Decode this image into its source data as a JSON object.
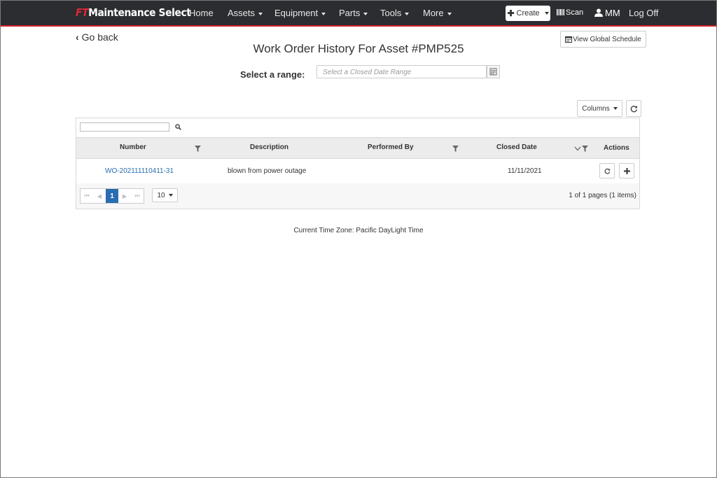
{
  "nav": {
    "brand_prefix": "FT",
    "brand_name": "Maintenance Select",
    "items": [
      {
        "label": "Home"
      },
      {
        "label": "Assets"
      },
      {
        "label": "Equipment"
      },
      {
        "label": "Parts"
      },
      {
        "label": "Tools"
      },
      {
        "label": "More"
      }
    ],
    "create_label": "Create",
    "scan_label": "Scan",
    "user_label": "MM",
    "logoff_label": "Log Off",
    "accent_color": "#d0222f"
  },
  "page": {
    "go_back": "Go back",
    "title": "Work Order History For Asset #PMP525",
    "global_schedule": "View Global Schedule",
    "range_label": "Select a range:",
    "range_placeholder": "Select a Closed Date Range"
  },
  "grid": {
    "columns_label": "Columns",
    "headers": {
      "number": "Number",
      "description": "Description",
      "performed_by": "Performed By",
      "closed_date": "Closed Date",
      "actions": "Actions"
    },
    "rows": [
      {
        "number": "WO-202111110411-31",
        "description": "blown from power outage",
        "performed_by": "",
        "closed_date": "11/11/2021"
      }
    ],
    "pager": {
      "current_page": "1",
      "page_size": "10",
      "info": "1 of 1 pages (1 items)"
    }
  },
  "footer": {
    "timezone": "Current Time Zone: Pacific DayLight Time"
  }
}
